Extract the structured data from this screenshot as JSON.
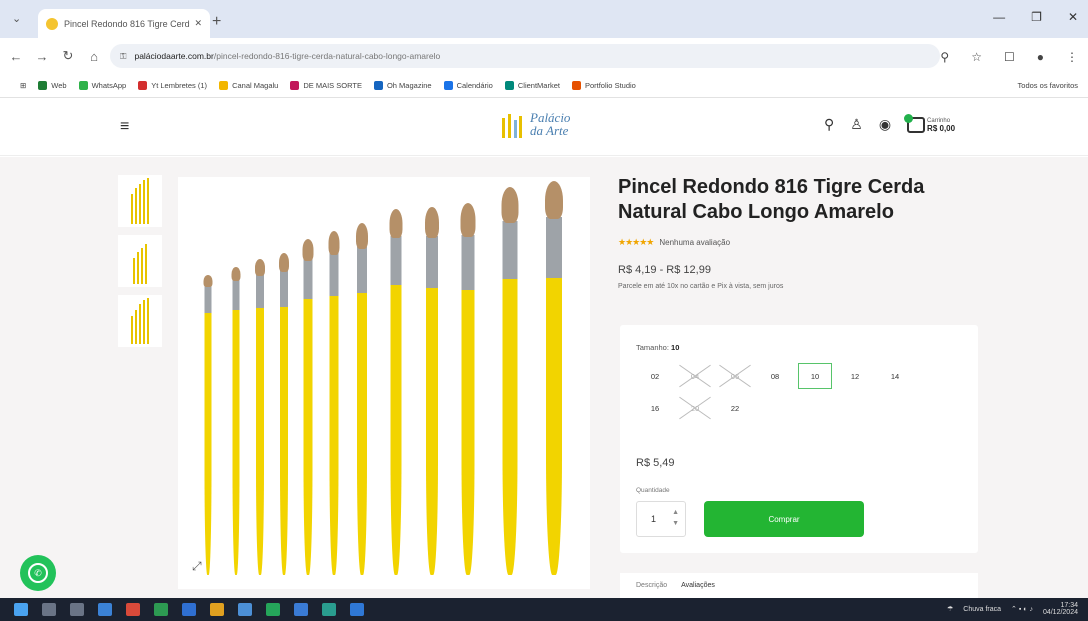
{
  "browser": {
    "tab_title": "Pincel Redondo 816 Tigre Cerd",
    "tab_close": "✕",
    "new_tab": "+",
    "url_domain": "paláciodaarte.com.br",
    "url_path": "/pincel-redondo-816-tigre-cerda-natural-cabo-longo-amarelo",
    "bookmarks": [
      {
        "label": "Web",
        "color": "#1e7d35"
      },
      {
        "label": "WhatsApp",
        "color": "#2fb24a"
      },
      {
        "label": "Yt Lembretes (1)",
        "color": "#d32f2f"
      },
      {
        "label": "Canal Magalu",
        "color": "#f2b600"
      },
      {
        "label": "DE MAIS SORTE",
        "color": "#c2185b"
      },
      {
        "label": "Oh Magazine",
        "color": "#1565c0"
      },
      {
        "label": "Calendário",
        "color": "#1a73e8"
      },
      {
        "label": "ClientMarket",
        "color": "#00897b"
      },
      {
        "label": "Portfolio Studio",
        "color": "#e65100"
      }
    ],
    "all_bookmarks": "Todos os favoritos"
  },
  "site": {
    "logo_line1": "Palácio",
    "logo_line2": "da Arte",
    "cart_label": "Carrinho",
    "cart_total": "R$ 0,00"
  },
  "product": {
    "title": "Pincel Redondo 816 Tigre Cerda Natural Cabo Longo Amarelo",
    "stars": "★★★★★",
    "reviews": "Nenhuma avaliação",
    "price_range": "R$ 4,19 - R$ 12,99",
    "installments": "Parcele em até 10x no cartão e Pix à vista, sem juros",
    "option_label": "Tamanho:",
    "option_value": "10",
    "sizes": [
      {
        "label": "02",
        "state": "available"
      },
      {
        "label": "04",
        "state": "disabled"
      },
      {
        "label": "06",
        "state": "disabled"
      },
      {
        "label": "08",
        "state": "available"
      },
      {
        "label": "10",
        "state": "selected"
      },
      {
        "label": "12",
        "state": "available"
      },
      {
        "label": "14",
        "state": "available"
      },
      {
        "label": "16",
        "state": "available"
      },
      {
        "label": "20",
        "state": "disabled"
      },
      {
        "label": "22",
        "state": "available"
      }
    ],
    "variant_price": "R$ 5,49",
    "qty_label": "Quantidade",
    "qty": "1",
    "buy_label": "Comprar",
    "tabs": [
      "Descrição",
      "Avaliações"
    ]
  },
  "taskbar": {
    "weather": "Chuva fraca",
    "time": "17:34",
    "date": "04/12/2024"
  }
}
